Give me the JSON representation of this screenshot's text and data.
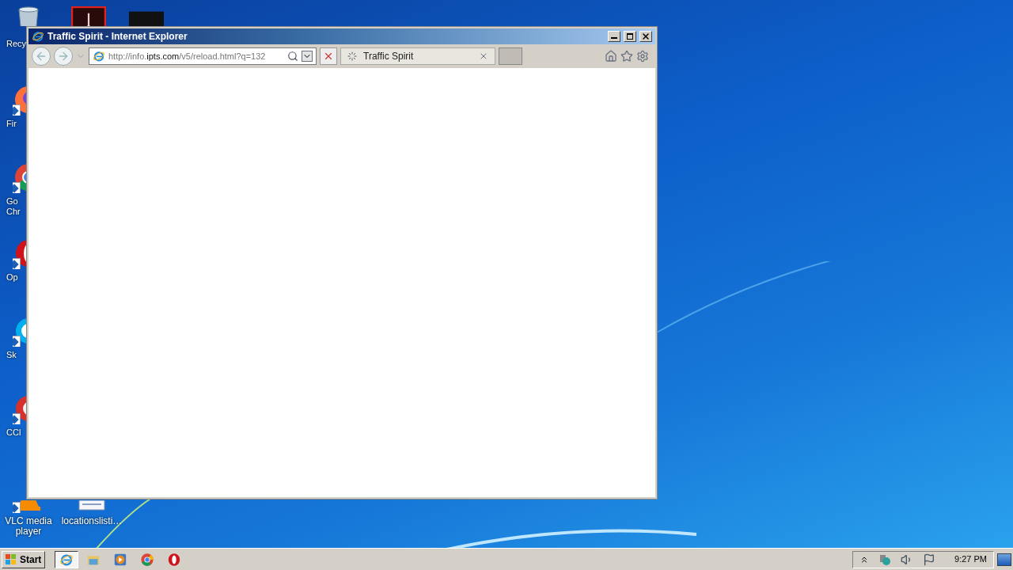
{
  "desktop_icons": [
    {
      "kind": "recycle",
      "lines": [
        "Recy"
      ]
    },
    {
      "kind": "firefox",
      "lines": [
        "Fir"
      ]
    },
    {
      "kind": "chrome",
      "lines": [
        "Go",
        "Chr"
      ]
    },
    {
      "kind": "opera",
      "lines": [
        "Op"
      ]
    },
    {
      "kind": "skype",
      "lines": [
        "Sk"
      ]
    },
    {
      "kind": "ccleaner",
      "lines": [
        "CCl"
      ]
    },
    {
      "kind": "vlc",
      "lines": [
        "VLC media",
        "player"
      ]
    },
    {
      "kind": "file",
      "lines": [
        "locationslisti…"
      ]
    }
  ],
  "top_icons": [
    {
      "kind": "acrobat"
    },
    {
      "kind": "dark"
    }
  ],
  "window": {
    "title": "Traffic Spirit - Internet Explorer",
    "address": {
      "before": "http://info.",
      "domain": "ipts.com",
      "after": "/v5/reload.html?q=132"
    },
    "tabs": [
      {
        "label": "Traffic Spirit",
        "loading": true,
        "selected": true
      }
    ]
  },
  "taskbar": {
    "start": "Start",
    "items": [
      {
        "kind": "ie",
        "selected": true
      },
      {
        "kind": "folder",
        "selected": false
      },
      {
        "kind": "media",
        "selected": false
      },
      {
        "kind": "chrome",
        "selected": false
      },
      {
        "kind": "opera",
        "selected": false
      }
    ],
    "clock": "9:27 PM"
  }
}
